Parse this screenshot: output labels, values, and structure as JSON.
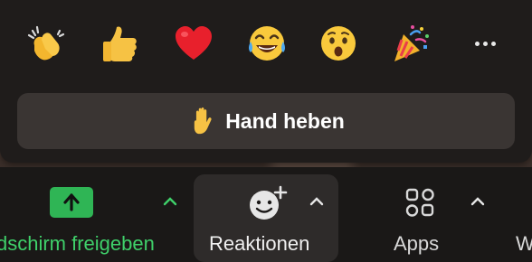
{
  "reactions_popup": {
    "emojis": [
      "clapping-hands",
      "thumbs-up",
      "red-heart",
      "tears-of-joy",
      "surprised-face",
      "party-popper"
    ],
    "raise_hand_label": "Hand heben"
  },
  "toolbar": {
    "share_label": "Bildschirm freigeben",
    "share_label_visible": "dschirm freigeben",
    "reactions_label": "Reaktionen",
    "apps_label": "Apps",
    "next_label_partial": "W"
  },
  "colors": {
    "share_green": "#2fb555",
    "caret_green": "#3fd06a",
    "popup_bg": "#1f1c1b",
    "raise_hand_bg": "#3a3533"
  }
}
